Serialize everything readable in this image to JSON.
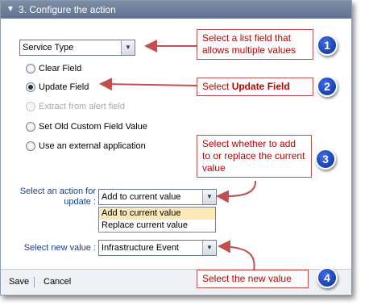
{
  "panel": {
    "title": "3. Configure the action",
    "collapse_glyph": "▼"
  },
  "list_field": {
    "value": "Service Type",
    "arrow_glyph": "▼"
  },
  "options": [
    {
      "label": "Clear Field",
      "selected": false,
      "disabled": false
    },
    {
      "label": "Update Field",
      "selected": true,
      "disabled": false
    },
    {
      "label": "Extract from alert field",
      "selected": false,
      "disabled": true
    },
    {
      "label": "Set Old Custom Field Value",
      "selected": false,
      "disabled": false
    },
    {
      "label": "Use an external application",
      "selected": false,
      "disabled": false
    }
  ],
  "update_action": {
    "label": "Select an action for update :",
    "value": "Add to current value",
    "dropdown_options": [
      "Add to current value",
      "Replace current value"
    ]
  },
  "new_value": {
    "label": "Select new value :",
    "value": "Infrastructure Event"
  },
  "footer": {
    "save_label": "Save",
    "cancel_label": "Cancel"
  },
  "callouts": [
    {
      "number": "1",
      "text": "Select a list field that allows multiple values"
    },
    {
      "number": "2",
      "text_prefix": "Select ",
      "text_bold": "Update Field"
    },
    {
      "number": "3",
      "text": "Select whether to add to or replace the current value"
    },
    {
      "number": "4",
      "text": "Select the new value"
    }
  ],
  "colors": {
    "titlebar": "#6a7b98",
    "label_blue": "#1b3f8f",
    "callout_red": "#c00000",
    "badge_blue": "#1a3fc4"
  }
}
